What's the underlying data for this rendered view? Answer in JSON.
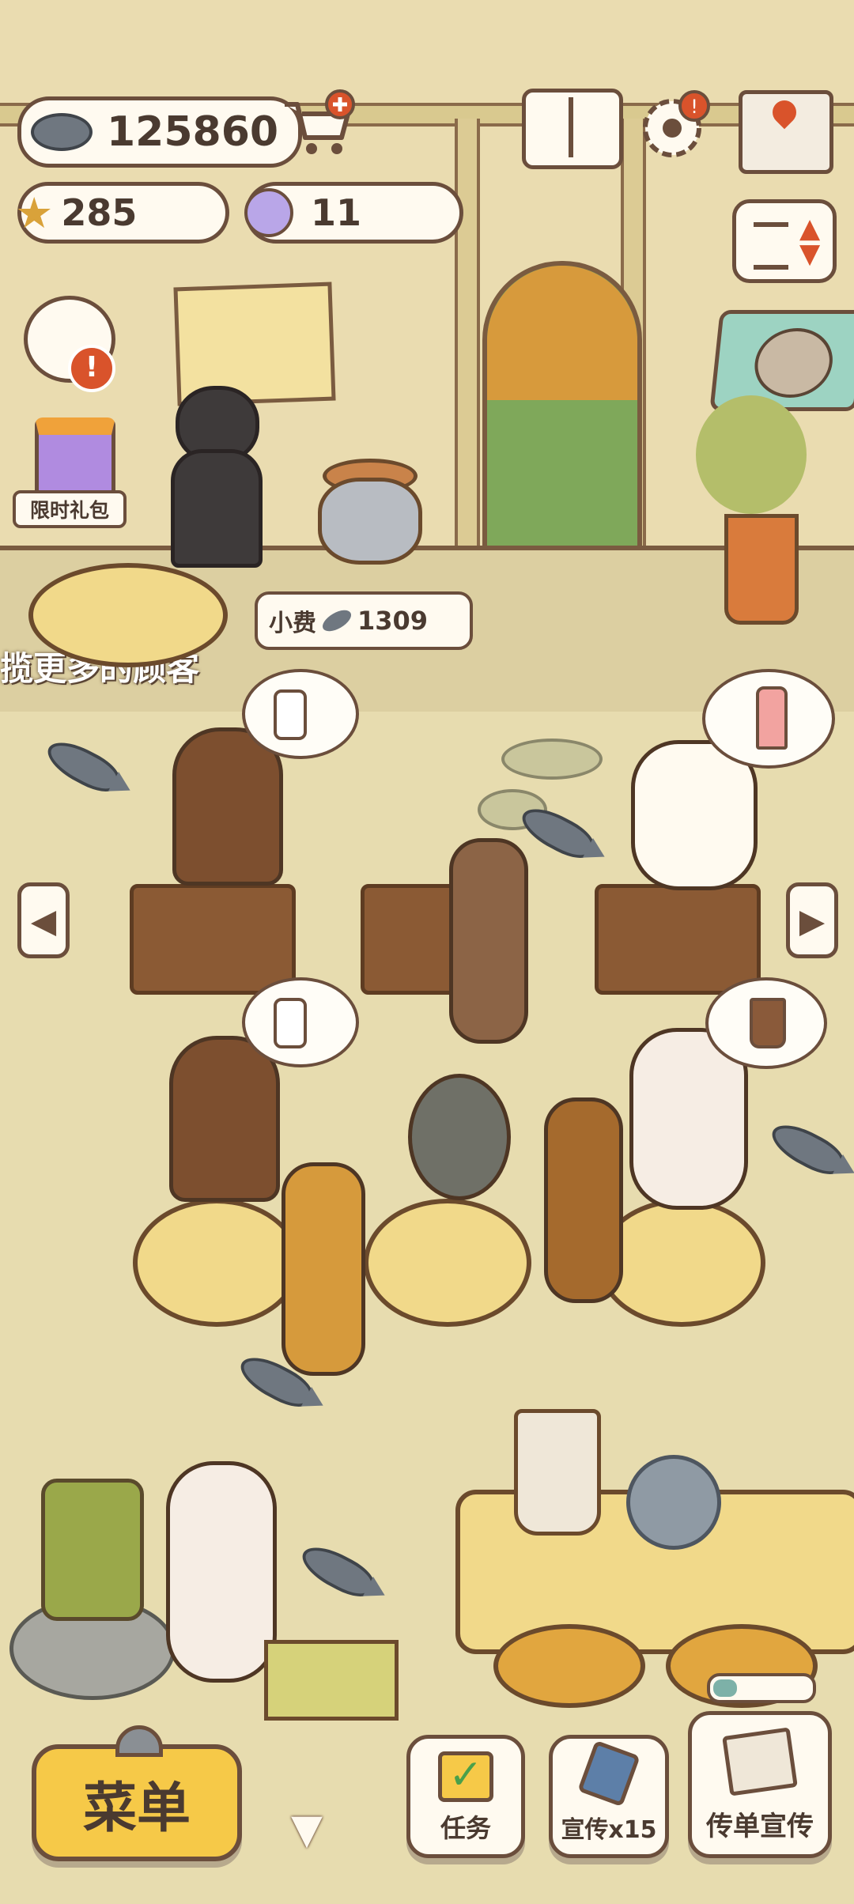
{
  "currency": {
    "fish": "125860",
    "stars": "285",
    "paw_tokens": "11"
  },
  "tip": {
    "label": "小费",
    "amount": "1309"
  },
  "marquee_text": "揽更多的顾客",
  "gift": {
    "label": "限时礼包"
  },
  "bottom_bar": {
    "menu_label": "菜单",
    "tasks_label": "任务",
    "promote_label": "宣传x15",
    "flyer_label": "传单宣传"
  },
  "colors": {
    "accent_brown": "#6b4e3c",
    "menu_yellow": "#f6c948",
    "alert_red": "#d9532b"
  }
}
